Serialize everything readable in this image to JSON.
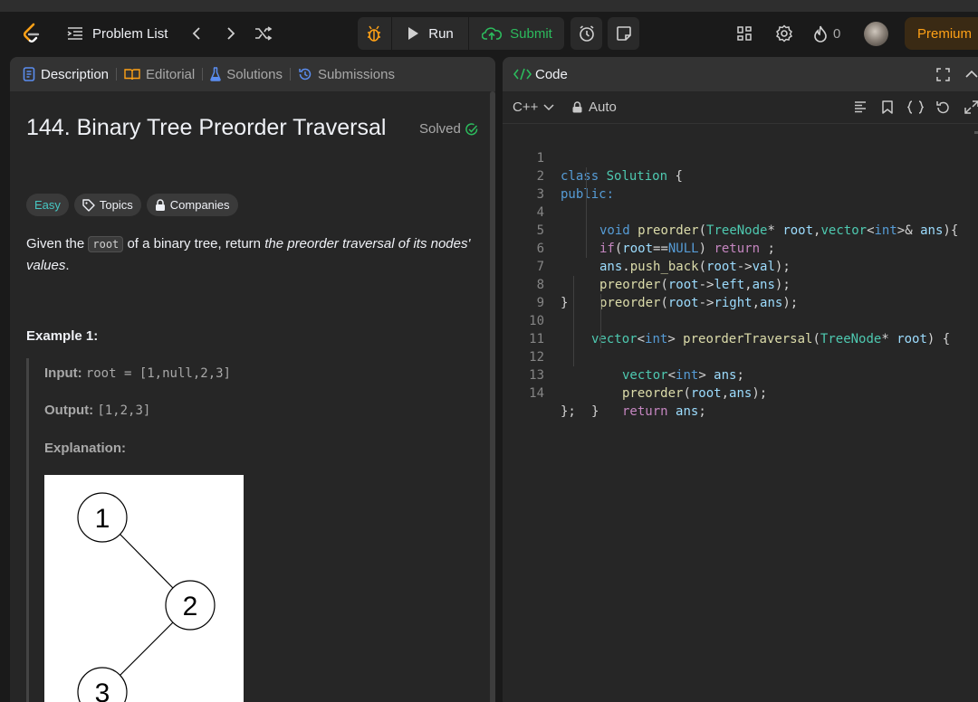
{
  "nav": {
    "problem_list": "Problem List",
    "run": "Run",
    "submit": "Submit",
    "streak_count": "0",
    "premium": "Premium"
  },
  "left_tabs": [
    {
      "label": "Description",
      "icon": "description-icon",
      "color": "#5b8def"
    },
    {
      "label": "Editorial",
      "icon": "book-icon",
      "color": "#ffa116"
    },
    {
      "label": "Solutions",
      "icon": "flask-icon",
      "color": "#5b8def"
    },
    {
      "label": "Submissions",
      "icon": "history-icon",
      "color": "#5b8def"
    }
  ],
  "problem": {
    "title": "144. Binary Tree Preorder Traversal",
    "status": "Solved",
    "difficulty": "Easy",
    "topics": "Topics",
    "companies": "Companies",
    "desc_pre": "Given the ",
    "desc_code": "root",
    "desc_mid": " of a binary tree, return ",
    "desc_em": "the preorder traversal of its nodes' values",
    "desc_end": ".",
    "example_title": "Example 1:",
    "input_label": "Input:",
    "input_value": "root = [1,null,2,3]",
    "output_label": "Output:",
    "output_value": "[1,2,3]",
    "explanation_label": "Explanation:",
    "tree_nodes": [
      "1",
      "2",
      "3"
    ]
  },
  "editor": {
    "title": "Code",
    "language": "C++",
    "mode": "Auto",
    "lines": [
      "class Solution {",
      "public:",
      "void preorder(TreeNode* root,vector<int>& ans){",
      "if(root==NULL) return ;",
      "ans.push_back(root->val);",
      "preorder(root->left,ans);",
      "preorder(root->right,ans);",
      "}",
      "vector<int> preorderTraversal(TreeNode* root) {",
      "vector<int> ans;",
      "preorder(root,ans);",
      "return ans;",
      "}",
      "};"
    ],
    "line_numbers": [
      "1",
      "2",
      "3",
      "4",
      "5",
      "6",
      "7",
      "8",
      "9",
      "10",
      "11",
      "12",
      "13",
      "14"
    ]
  },
  "colors": {
    "accent": "#ffa116",
    "submit_green": "#2cbb5d",
    "easy": "#46c6c2"
  }
}
